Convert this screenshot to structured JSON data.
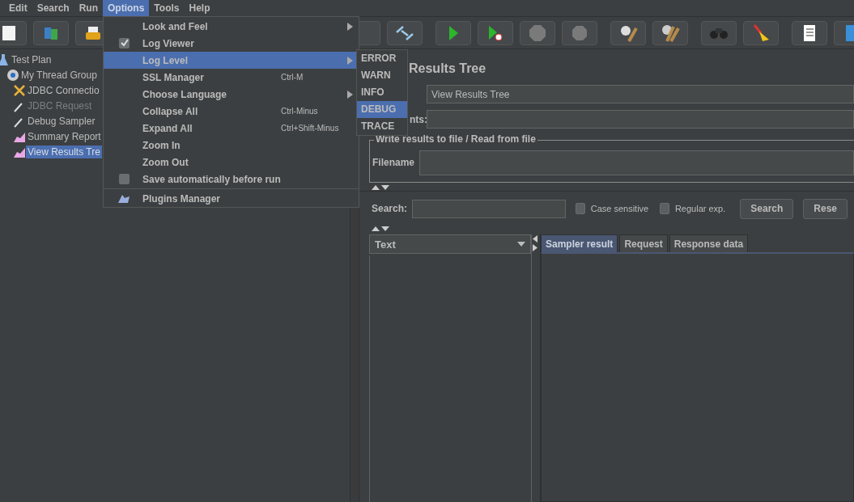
{
  "menubar": [
    {
      "label": "Edit",
      "selected": false
    },
    {
      "label": "Search",
      "selected": false
    },
    {
      "label": "Run",
      "selected": false
    },
    {
      "label": "Options",
      "selected": true
    },
    {
      "label": "Tools",
      "selected": false
    },
    {
      "label": "Help",
      "selected": false
    }
  ],
  "options_menu": [
    {
      "kind": "submenu",
      "label": "Look and Feel",
      "selected": false
    },
    {
      "kind": "check",
      "label": "Log Viewer",
      "checked": true,
      "selected": false
    },
    {
      "kind": "submenu",
      "label": "Log Level",
      "selected": true
    },
    {
      "kind": "item",
      "label": "SSL Manager",
      "shortcut": "Ctrl-M",
      "selected": false
    },
    {
      "kind": "submenu",
      "label": "Choose Language",
      "selected": false
    },
    {
      "kind": "item",
      "label": "Collapse All",
      "shortcut": "Ctrl-Minus",
      "selected": false
    },
    {
      "kind": "item",
      "label": "Expand All",
      "shortcut": "Ctrl+Shift-Minus",
      "selected": false
    },
    {
      "kind": "item",
      "label": "Zoom In",
      "selected": false
    },
    {
      "kind": "item",
      "label": "Zoom Out",
      "selected": false
    },
    {
      "kind": "check",
      "label": "Save automatically before run",
      "checked": false,
      "selected": false
    },
    {
      "kind": "separator"
    },
    {
      "kind": "plugin",
      "label": "Plugins Manager",
      "selected": false
    }
  ],
  "log_level_menu": [
    {
      "label": "ERROR",
      "selected": false
    },
    {
      "label": "WARN",
      "selected": false
    },
    {
      "label": "INFO",
      "selected": false
    },
    {
      "label": "DEBUG",
      "selected": true
    },
    {
      "label": "TRACE",
      "selected": false
    }
  ],
  "tree": [
    {
      "kind": "plan",
      "label": "Test Plan",
      "selected": false,
      "disabled": false,
      "children": [
        {
          "kind": "thread-group",
          "label": "My Thread Group",
          "selected": false,
          "disabled": false,
          "children": [
            {
              "kind": "config",
              "label": "JDBC Connectio",
              "selected": false,
              "disabled": false
            },
            {
              "kind": "sampler",
              "label": "JDBC Request",
              "selected": false,
              "disabled": true
            },
            {
              "kind": "sampler",
              "label": "Debug Sampler",
              "selected": false,
              "disabled": false
            },
            {
              "kind": "listener",
              "label": "Summary Report",
              "selected": false,
              "disabled": false
            },
            {
              "kind": "listener",
              "label": "View Results Tre",
              "selected": true,
              "disabled": false
            }
          ]
        }
      ]
    }
  ],
  "panel": {
    "title": "Results Tree",
    "name_value": "View Results Tree",
    "comments_label": "nts:",
    "file_group": {
      "title": "Write results to file / Read from file",
      "filename_label": "Filename"
    },
    "search": {
      "label": "Search:",
      "options": [
        {
          "label": "Case sensitive",
          "checked": false
        },
        {
          "label": "Regular exp.",
          "checked": false
        }
      ],
      "buttons": [
        "Search",
        "Rese"
      ]
    },
    "renderer": "Text",
    "tabs": [
      {
        "label": "Sampler result",
        "selected": true
      },
      {
        "label": "Request",
        "selected": false
      },
      {
        "label": "Response data",
        "selected": false
      }
    ]
  }
}
